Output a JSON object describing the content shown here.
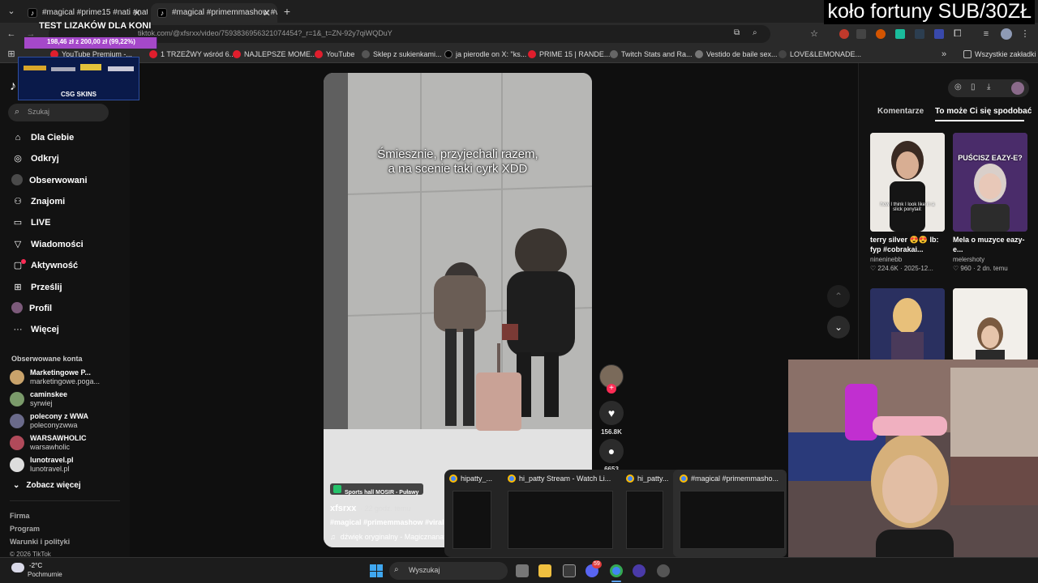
{
  "browser": {
    "tabs": [
      {
        "label": "#magical #prime15 #nati #natu"
      },
      {
        "label": "#magical #primemmashow #vi"
      }
    ],
    "url": "tiktok.com/@xfsrxx/video/7593836956321074454?_r=1&_t=ZN-92y7qiWQDuY",
    "bookmarks": [
      "YouTube Premium -...",
      "1 TRZEŹWY wśród 6...",
      "NAJLEPSZE MOME...",
      "YouTube",
      "Sklep z sukienkami...",
      "ja pierodle on X: \"ks...",
      "PRIME 15 | RANDE...",
      "Twitch Stats and Ra...",
      "Vestido de baile sex...",
      "LOVE&LEMONADE..."
    ],
    "all_bookmarks": "Wszystkie zakładki"
  },
  "stream_overlay": {
    "title_right": "koło fortuny SUB/30ZŁ",
    "goal_title": "TEST LIZAKÓW DLA KONI",
    "goal_progress": "198,46 zł z 200,00 zł (99,22%)",
    "goal_fraction": 0.9922,
    "sponsor": "CSG SKINS"
  },
  "sidebar": {
    "search_placeholder": "Szukaj",
    "nav": [
      {
        "label": "Dla Ciebie",
        "icon": "home-icon"
      },
      {
        "label": "Odkryj",
        "icon": "compass-icon"
      },
      {
        "label": "Obserwowani",
        "icon": "following-icon"
      },
      {
        "label": "Znajomi",
        "icon": "friends-icon"
      },
      {
        "label": "LIVE",
        "icon": "live-icon"
      },
      {
        "label": "Wiadomości",
        "icon": "messages-icon"
      },
      {
        "label": "Aktywność",
        "icon": "activity-icon"
      },
      {
        "label": "Prześlij",
        "icon": "upload-icon"
      },
      {
        "label": "Profil",
        "icon": "profile-icon"
      },
      {
        "label": "Więcej",
        "icon": "more-icon"
      }
    ],
    "following_header": "Obserwowane konta",
    "following": [
      {
        "name": "Marketingowe P...",
        "handle": "marketingowe.poga..."
      },
      {
        "name": "caminskee",
        "handle": "syrwiej"
      },
      {
        "name": "polecony z WWA",
        "handle": "poleconyzwwa"
      },
      {
        "name": "WARSAWHOLIC",
        "handle": "warsawholic"
      },
      {
        "name": "lunotravel.pl",
        "handle": "lunotravel.pl"
      }
    ],
    "see_more": "Zobacz więcej",
    "footer": [
      "Firma",
      "Program",
      "Warunki i polityki",
      "© 2026 TikTok"
    ]
  },
  "video": {
    "caption": "Śmiesznie, przyjechali razem,\na na scenie taki cyrk XDD",
    "location": "Sports hall MOSIR - Puławy",
    "author": "xfsrxx",
    "posted": "· 22 godz. temu",
    "tags": "#magical #primemmashow #viral #",
    "sound": "dźwięk oryginalny - Magicznanat",
    "likes": "156.8K",
    "comments": "6653"
  },
  "right_panel": {
    "tabs": [
      "Komentarze",
      "To może Ci się spodobać"
    ],
    "cards": [
      {
        "title": "terry silver 😍😍 lb: fyp #cobrakai...",
        "author": "nineninebb",
        "likes": "224.6K",
        "date": "2025-12...",
        "overlay_text": "how I think I look like in a slick ponytail:"
      },
      {
        "title": "Mela o muzyce eazy-e...",
        "author": "melershoty",
        "likes": "960",
        "date": "2 dn. temu",
        "overlay_text": "PUŚCISZ EAZY-E?"
      },
      {
        "title": "",
        "author": "",
        "likes": "",
        "date": "",
        "overlay_text": ""
      },
      {
        "title": "",
        "author": "",
        "likes": "",
        "date": "",
        "overlay_text": ""
      }
    ]
  },
  "thumbnail_bar": [
    {
      "title": "hipatty_..."
    },
    {
      "title": "hi_patty Stream - Watch Li..."
    },
    {
      "title": "hi_patty..."
    },
    {
      "title": "#magical #primemmasho..."
    }
  ],
  "taskbar": {
    "weather_temp": "-2°C",
    "weather_desc": "Pochmurnie",
    "search": "Wyszukaj",
    "discord_badge": "59"
  }
}
